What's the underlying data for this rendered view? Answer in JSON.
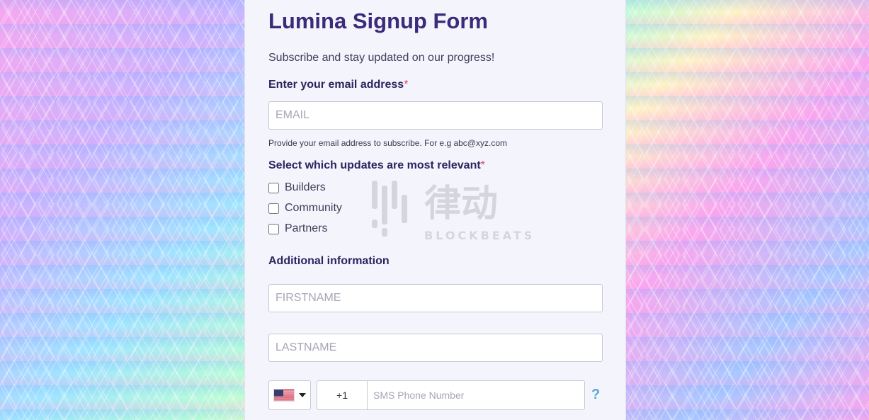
{
  "form": {
    "title": "Lumina Signup Form",
    "subtitle": "Subscribe and stay updated on our progress!",
    "email": {
      "label": "Enter your email address",
      "required_mark": "*",
      "placeholder": "EMAIL",
      "help": "Provide your email address to subscribe. For e.g abc@xyz.com"
    },
    "updates": {
      "label": "Select which updates are most relevant",
      "required_mark": "*",
      "options": [
        "Builders",
        "Community",
        "Partners"
      ]
    },
    "additional": {
      "label": "Additional information",
      "firstname_placeholder": "FIRSTNAME",
      "lastname_placeholder": "LASTNAME"
    },
    "phone": {
      "country_icon": "us-flag-icon",
      "code": "+1",
      "placeholder": "SMS Phone Number",
      "help_glyph": "?"
    }
  },
  "watermark": {
    "text_cn": "律动",
    "text_en": "BLOCKBEATS"
  },
  "colors": {
    "title": "#3c2a7a",
    "required": "#e0436a",
    "help_icon": "#5aa7d6",
    "panel_bg": "#f3f4fc"
  }
}
